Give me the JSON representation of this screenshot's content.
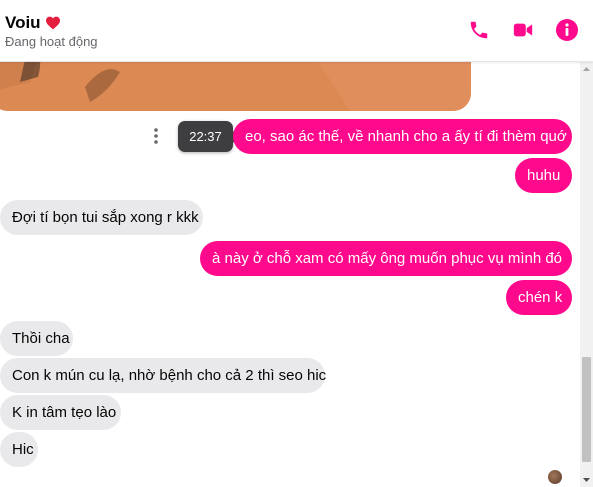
{
  "header": {
    "contact_name": "Voiu",
    "status": "Đang hoạt động",
    "buttons": [
      "phone-icon",
      "video-camera-icon",
      "info-icon"
    ]
  },
  "colors": {
    "accent": "#ff0a8d",
    "incoming_bubble": "#e9e9eb",
    "heart": "#e41e3f"
  },
  "tooltip": {
    "time": "22:37"
  },
  "messages": [
    {
      "direction": "out",
      "text": "eo, sao ác thế, về nhanh cho a ấy tí đi thèm quớ"
    },
    {
      "direction": "out",
      "text": "huhu"
    },
    {
      "direction": "in",
      "text": "Đợi tí bọn tui sắp xong r kkk"
    },
    {
      "direction": "out",
      "text": "à này ở chỗ xam có mấy ông muốn phục vụ mình đó"
    },
    {
      "direction": "out",
      "text": "chén k"
    },
    {
      "direction": "in",
      "text": "Thồi cha"
    },
    {
      "direction": "in",
      "text": "Con k mún cu lạ, nhờ bệnh cho cả 2 thì seo hic"
    },
    {
      "direction": "in",
      "text": "K in tâm tẹo lào"
    },
    {
      "direction": "in",
      "text": "Hic"
    }
  ]
}
